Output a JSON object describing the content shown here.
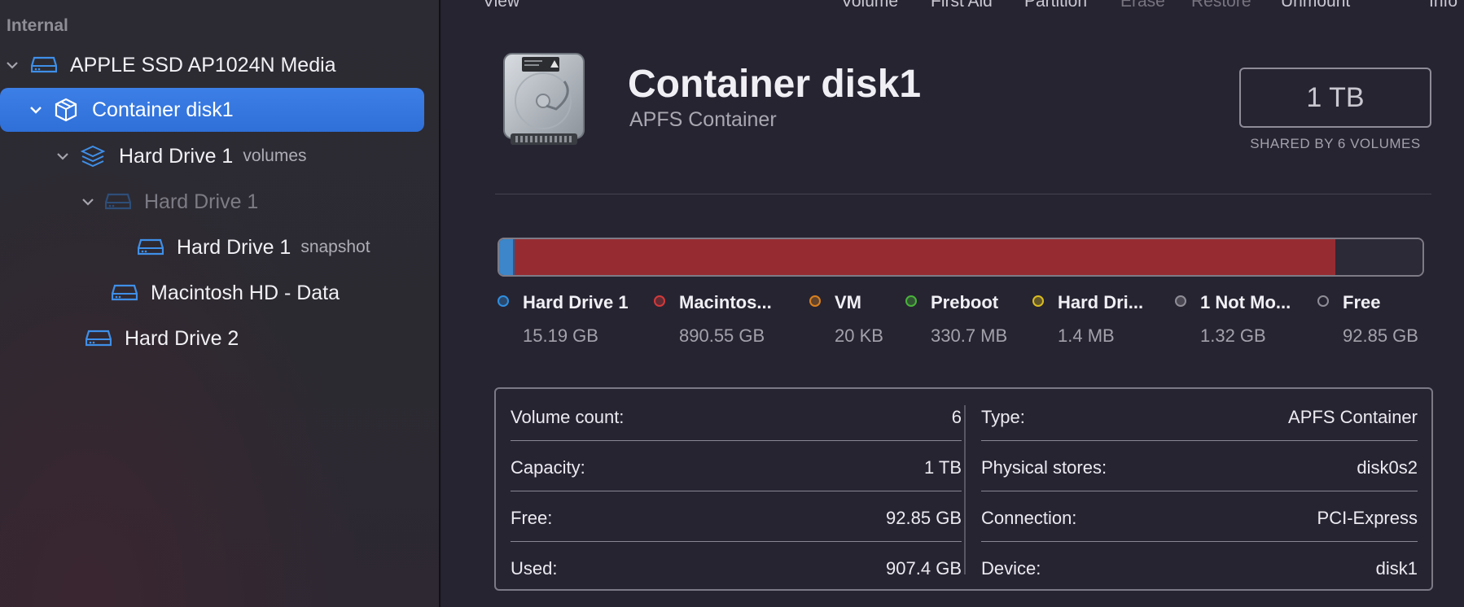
{
  "sidebar": {
    "section_title": "Internal",
    "items": [
      {
        "label": "APPLE SSD AP1024N Media",
        "sub": "",
        "icon": "drive-icon"
      },
      {
        "label": "Container disk1",
        "sub": "",
        "icon": "container-icon"
      },
      {
        "label": "Hard Drive 1",
        "sub": "volumes",
        "icon": "volume-group-icon"
      },
      {
        "label": "Hard Drive 1",
        "sub": "",
        "icon": "drive-icon"
      },
      {
        "label": "Hard Drive 1",
        "sub": "snapshot",
        "icon": "drive-icon"
      },
      {
        "label": "Macintosh HD - Data",
        "sub": "",
        "icon": "drive-icon"
      },
      {
        "label": "Hard Drive 2",
        "sub": "",
        "icon": "drive-icon"
      }
    ]
  },
  "toolbar": {
    "view": "View",
    "volume": "Volume",
    "first_aid": "First Aid",
    "partition": "Partition",
    "erase": "Erase",
    "restore": "Restore",
    "unmount": "Unmount",
    "info": "Info"
  },
  "header": {
    "title": "Container disk1",
    "subtitle": "APFS Container",
    "capacity": "1 TB",
    "capacity_sub": "SHARED BY 6 VOLUMES"
  },
  "usage": {
    "segments": [
      {
        "name": "Hard Drive 1",
        "fraction": 0.0152,
        "color": "#3c86c9"
      },
      {
        "name": "Macintosh HD - Data",
        "fraction": 0.8906,
        "color": "#962c31"
      },
      {
        "name": "Free",
        "fraction": 0.0942,
        "color": "#2c2a36"
      }
    ]
  },
  "legend": [
    {
      "name": "Hard Drive 1",
      "size": "15.19 GB",
      "color": "#2f8fe0"
    },
    {
      "name": "Macintos...",
      "size": "890.55 GB",
      "color": "#d23a3a"
    },
    {
      "name": "VM",
      "size": "20 KB",
      "color": "#d9801e"
    },
    {
      "name": "Preboot",
      "size": "330.7 MB",
      "color": "#49b33a"
    },
    {
      "name": "Hard Dri...",
      "size": "1.4 MB",
      "color": "#d9bc1f"
    },
    {
      "name": "1 Not Mo...",
      "size": "1.32 GB",
      "color": "#8f8d96"
    },
    {
      "name": "Free",
      "size": "92.85 GB",
      "color": "#8f8d96"
    }
  ],
  "info": {
    "left": [
      {
        "key": "Volume count:",
        "value": "6"
      },
      {
        "key": "Capacity:",
        "value": "1 TB"
      },
      {
        "key": "Free:",
        "value": "92.85 GB"
      },
      {
        "key": "Used:",
        "value": "907.4 GB"
      }
    ],
    "right": [
      {
        "key": "Type:",
        "value": "APFS Container"
      },
      {
        "key": "Physical stores:",
        "value": "disk0s2"
      },
      {
        "key": "Connection:",
        "value": "PCI-Express"
      },
      {
        "key": "Device:",
        "value": "disk1"
      }
    ]
  }
}
